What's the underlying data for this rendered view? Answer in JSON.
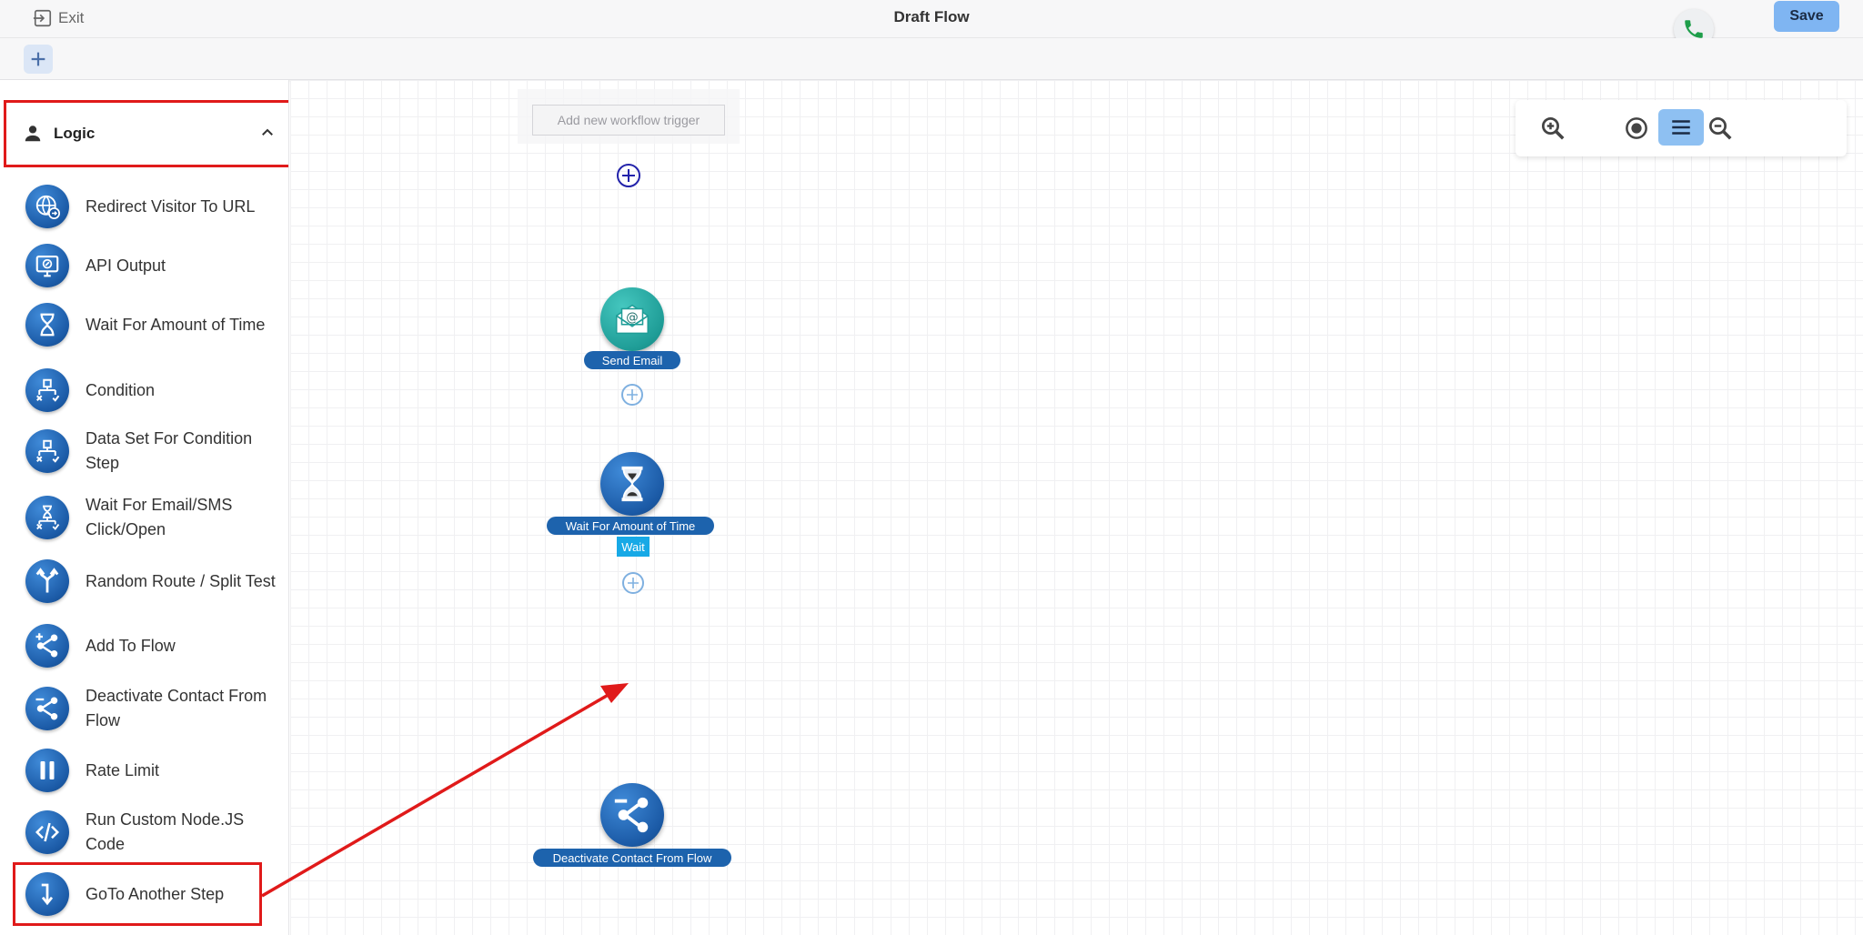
{
  "header": {
    "exit_label": "Exit",
    "title": "Draft Flow",
    "save_label": "Save",
    "phone_icon": "phone-icon"
  },
  "toolbar": {
    "add_icon": "plus-icon"
  },
  "sidebar": {
    "section_label": "Logic",
    "items": [
      {
        "label": "Redirect Visitor To URL",
        "icon": "globe-redirect-icon"
      },
      {
        "label": "API Output",
        "icon": "monitor-api-icon"
      },
      {
        "label": "Wait For Amount of Time",
        "icon": "hourglass-icon"
      },
      {
        "label": "Condition",
        "icon": "condition-branch-icon"
      },
      {
        "label": "Data Set For Condition Step",
        "icon": "condition-branch-icon"
      },
      {
        "label": "Wait For Email/SMS Click/Open",
        "icon": "hourglass-branch-icon"
      },
      {
        "label": "Random Route / Split Test",
        "icon": "split-route-icon"
      },
      {
        "label": "Add To Flow",
        "icon": "share-add-icon"
      },
      {
        "label": "Deactivate Contact From Flow",
        "icon": "share-remove-icon"
      },
      {
        "label": "Rate Limit",
        "icon": "pause-icon"
      },
      {
        "label": "Run Custom Node.JS Code",
        "icon": "code-icon"
      },
      {
        "label": "GoTo Another Step",
        "icon": "arrow-down-return-icon"
      }
    ]
  },
  "canvas": {
    "trigger_label": "Add new workflow trigger",
    "nodes": [
      {
        "label": "Send Email",
        "icon": "email-envelope-icon"
      },
      {
        "label": "Wait For Amount of Time",
        "icon": "hourglass-icon",
        "tag": "Wait"
      },
      {
        "label": "Deactivate Contact From Flow",
        "icon": "share-remove-icon"
      }
    ],
    "controls": {
      "zoom_in": "zoom-in-icon",
      "reset": "target-icon",
      "zoom_out": "zoom-out-icon",
      "menu": "hamburger-icon"
    }
  },
  "colors": {
    "highlight": "#e01a1a",
    "node_blue": "#1d63ad",
    "save_bg": "#7fb5f2",
    "wait_tag": "#17a9e6"
  }
}
